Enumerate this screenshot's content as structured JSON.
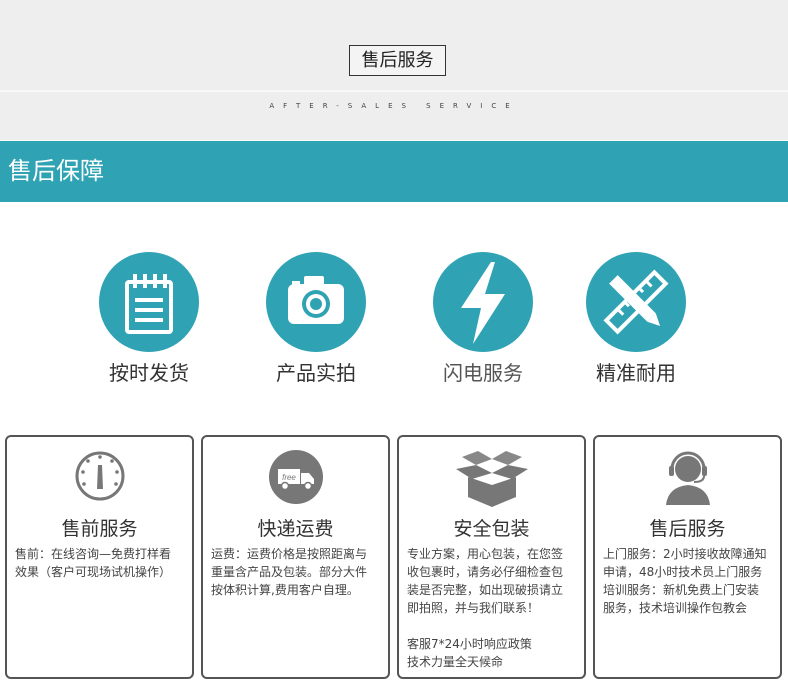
{
  "header": {
    "title": "售后服务",
    "subtitle": "AFTER-SALES SERVICE"
  },
  "banner": {
    "title": "售后保障"
  },
  "features": [
    {
      "label": "按时发货",
      "icon": "notepad-icon"
    },
    {
      "label": "产品实拍",
      "icon": "camera-icon"
    },
    {
      "label": "闪电服务",
      "icon": "lightning-icon"
    },
    {
      "label": "精准耐用",
      "icon": "ruler-pencil-icon"
    }
  ],
  "cards": [
    {
      "title": "售前服务",
      "icon": "gauge-icon",
      "text": "售前：在线咨询—免费打样看\n效果（客户可现场试机操作）"
    },
    {
      "title": "快递运费",
      "icon": "free-delivery-truck-icon",
      "text": "运费：运费价格是按照距离与\n重量含产品及包装。部分大件\n按体积计算,费用客户自理。"
    },
    {
      "title": "安全包装",
      "icon": "open-box-icon",
      "text": "专业方案，用心包装，在您签\n收包裹时，请务必仔细检查包\n装是否完整，如出现破损请立\n即拍照，并与我们联系！\n\n客服7*24小时响应政策\n技术力量全天候命"
    },
    {
      "title": "售后服务",
      "icon": "headset-agent-icon",
      "text": "上门服务：2小时接收故障通知\n申请，48小时技术员上门服务\n培训服务：新机免费上门安装\n服务，技术培训操作包教会"
    }
  ],
  "colors": {
    "accent": "#2fa3b4",
    "band": "#eeeeee",
    "icon_gray": "#777777"
  }
}
